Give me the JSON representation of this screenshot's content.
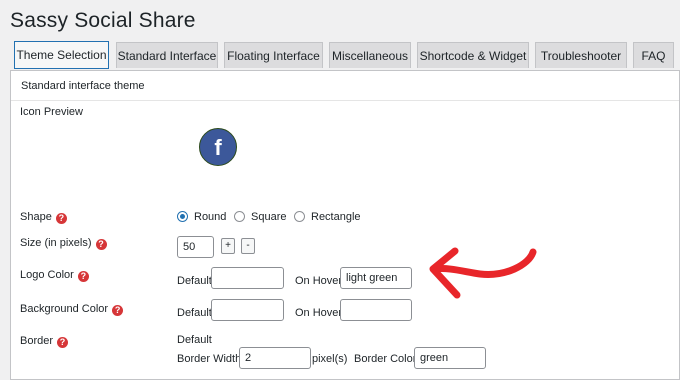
{
  "page": {
    "title": "Sassy Social Share"
  },
  "tabs": [
    {
      "label": "Theme Selection",
      "active": true
    },
    {
      "label": "Standard Interface"
    },
    {
      "label": "Floating Interface"
    },
    {
      "label": "Miscellaneous"
    },
    {
      "label": "Shortcode & Widget"
    },
    {
      "label": "Troubleshooter"
    },
    {
      "label": "FAQ"
    }
  ],
  "section": {
    "title": "Standard interface theme"
  },
  "icon_preview": {
    "label": "Icon Preview",
    "icon": "facebook-icon",
    "glyph": "f",
    "color": "#3c589a"
  },
  "shape": {
    "label": "Shape",
    "options": [
      "Round",
      "Square",
      "Rectangle"
    ],
    "selected": "Round"
  },
  "size": {
    "label": "Size (in pixels)",
    "value": "50",
    "plus": "+",
    "minus": "-"
  },
  "logo_color": {
    "label": "Logo Color",
    "default_label": "Default",
    "default_value": "",
    "hover_label": "On Hover",
    "hover_value": "light green"
  },
  "background_color": {
    "label": "Background Color",
    "default_label": "Default",
    "default_value": "",
    "hover_label": "On Hover",
    "hover_value": ""
  },
  "border": {
    "label": "Border",
    "sub_label": "Default",
    "width_label": "Border Width",
    "width_value": "2",
    "unit": "pixel(s)",
    "color_label": "Border Color",
    "color_value": "green"
  },
  "help_glyph": "?",
  "colors": {
    "accent": "#2271b1",
    "help": "#d63638",
    "annotation_arrow": "#e8262a"
  }
}
